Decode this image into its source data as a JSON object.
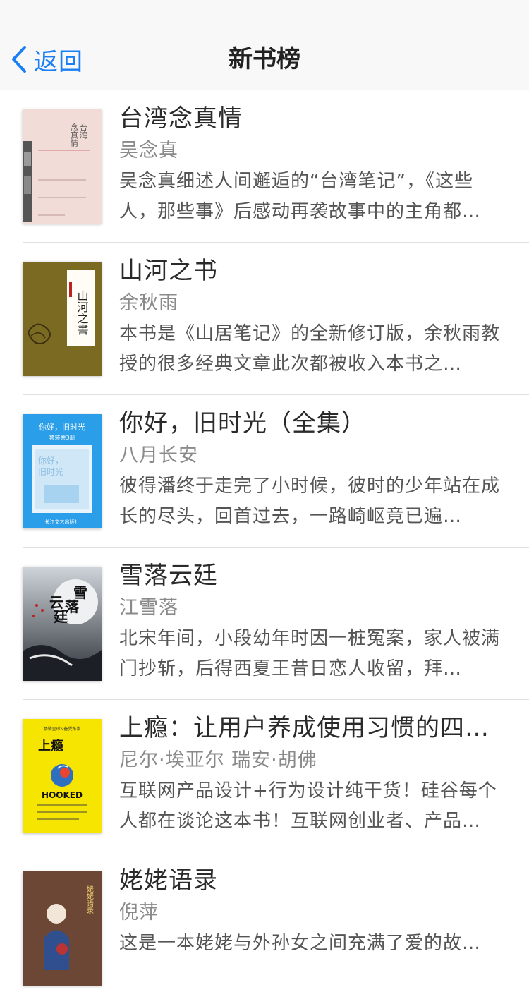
{
  "nav": {
    "back_label": "返回",
    "title": "新书榜",
    "accent": "#1a7ff5"
  },
  "books": [
    {
      "title": "台湾念真情",
      "author": "吴念真",
      "desc": "吴念真细述人间邂逅的“台湾笔记”，《这些人，那些事》后感动再袭故事中的主角都…",
      "cover_text": "台湾念真情"
    },
    {
      "title": "山河之书",
      "author": "余秋雨",
      "desc": "本书是《山居笔记》的全新修订版，余秋雨教授的很多经典文章此次都被收入本书之…",
      "cover_text": "山河之書"
    },
    {
      "title": "你好，旧时光（全集）",
      "author": "八月长安",
      "desc": "彼得潘终于走完了小时候，彼时的少年站在成长的尽头，回首过去，一路崎岖竟已遍…",
      "cover_text": "你好，旧时光"
    },
    {
      "title": "雪落云廷",
      "author": "江雪落",
      "desc": "北宋年间，小段幼年时因一桩冤案，家人被满门抄斩，后得西夏王昔日恋人收留，拜…",
      "cover_text": "雪落云廷"
    },
    {
      "title": "上瘾：让用户养成使用习惯的四大…",
      "author": "尼尔·埃亚尔 瑞安·胡佛",
      "desc": "互联网产品设计+行为设计纯干货！硅谷每个人都在谈论这本书！互联网创业者、产品…",
      "cover_text": "上瘾 HOOKED"
    },
    {
      "title": "姥姥语录",
      "author": "倪萍",
      "desc": "这是一本姥姥与外孙女之间充满了爱的故…",
      "cover_text": "姥姥语录"
    }
  ]
}
